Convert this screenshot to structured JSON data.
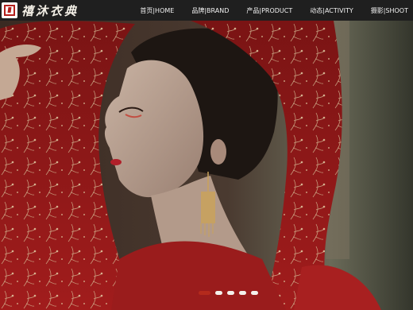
{
  "brand": {
    "name": "禧沐衣典",
    "logo_icon": "seal-logo-icon"
  },
  "nav": {
    "items": [
      {
        "label": "首页|HOME"
      },
      {
        "label": "品牌|BRAND"
      },
      {
        "label": "产品|PRODUCT"
      },
      {
        "label": "动态|ACTIVITY"
      },
      {
        "label": "摄影|SHOOT"
      }
    ]
  },
  "carousel": {
    "slide_count": 5,
    "active_index": 0
  },
  "colors": {
    "nav_bg": "#1f1f1f",
    "accent_red": "#b42a1c",
    "veil_red": "#8e1a1a"
  }
}
